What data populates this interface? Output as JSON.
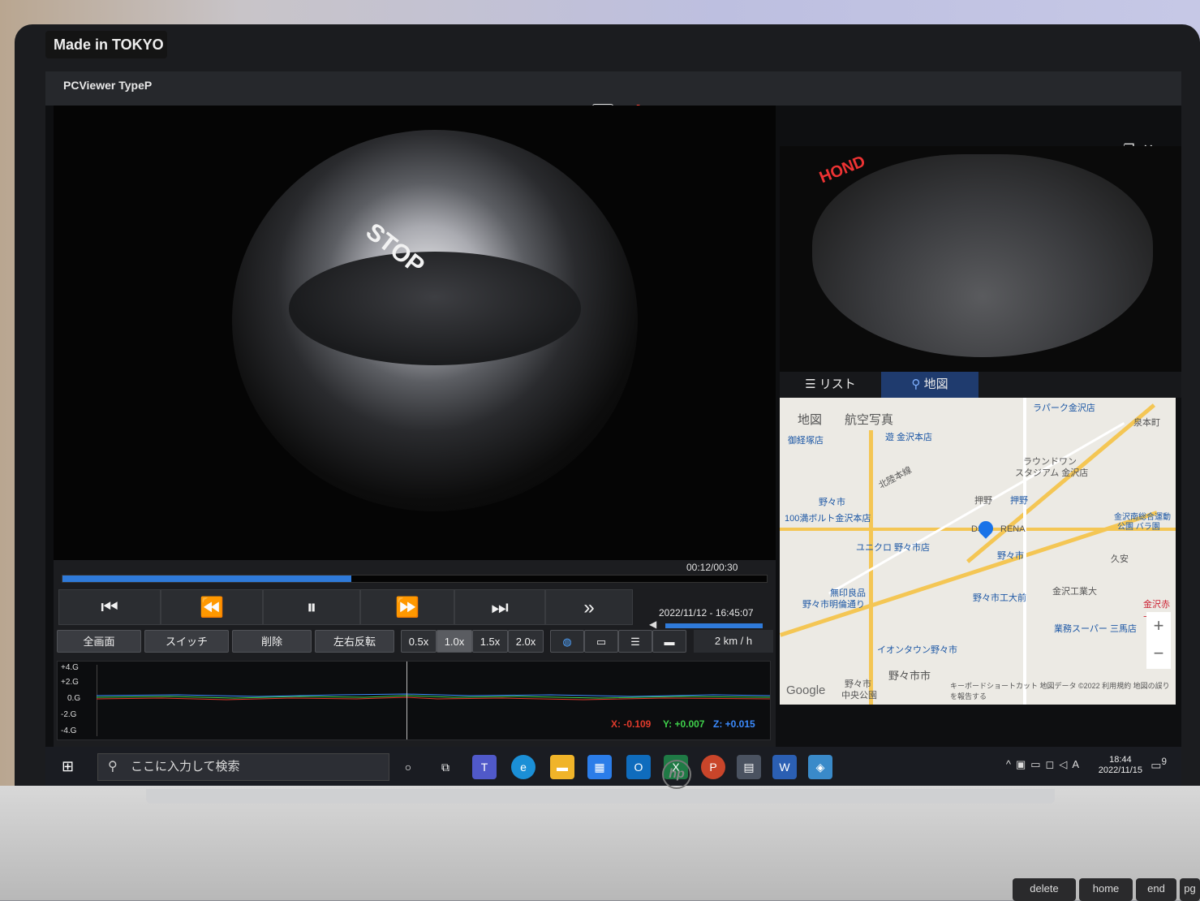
{
  "bezel": {
    "badge": "Made in TOKYO"
  },
  "app": {
    "title": "PCViewer TypeP"
  },
  "toolbar_icons": [
    "folder-icon",
    "sd-card-icon",
    "alert-icon",
    "print-icon",
    "camera-icon"
  ],
  "window_controls": {
    "minimize": "–",
    "restore": "❐",
    "close": "✕"
  },
  "main_video": {
    "sign_text": "STOP"
  },
  "rear_video": {
    "sign_text": "HOND"
  },
  "panel_tabs": [
    {
      "label": "リスト",
      "icon": "list-icon"
    },
    {
      "label": "地図",
      "icon": "map-pin-icon",
      "active": true
    }
  ],
  "map": {
    "mode_tabs": [
      "地図",
      "航空写真"
    ],
    "labels": [
      "ラパーク金沢店",
      "泉本町",
      "御経塚店",
      "遊 金沢本店",
      "北陸本線",
      "ラウンドワン",
      "スタジアム 金沢店",
      "野々市",
      "押野",
      "押野",
      "100満ボルト金沢本店",
      "DSC",
      "RENA",
      "金沢南総合運動",
      "公園 バラ園",
      "ユニクロ 野々市店",
      "野々市",
      "久安",
      "無印良品",
      "野々市明倫通り",
      "野々市工大前",
      "金沢工業大",
      "金沢赤十",
      "業務スーパー 三馬店",
      "イオンタウン野々市",
      "野々市",
      "中央公園",
      "野々市市"
    ],
    "attribution": "キーボードショートカット 地図データ ©2022 利用規約 地図の誤りを報告する",
    "logo": "Google",
    "zoom_in": "+",
    "zoom_out": "−"
  },
  "playback": {
    "time": "00:12/00:30",
    "progress": 0.41,
    "datetime": "2022/11/12 - 16:45:07",
    "volume": 1.0,
    "buttons": [
      "skip-start-icon",
      "rewind-icon",
      "pause-icon",
      "fast-forward-icon",
      "skip-end-icon",
      "double-chevron-icon"
    ]
  },
  "function_buttons": [
    "全画面",
    "スイッチ",
    "削除",
    "左右反転"
  ],
  "speed_buttons": [
    "0.5x",
    "1.0x",
    "1.5x",
    "2.0x"
  ],
  "speed_selected": "1.0x",
  "view_buttons": [
    "globe-icon",
    "single-view-icon",
    "split-view-icon",
    "wide-view-icon"
  ],
  "speedometer": "2 km / h",
  "gsensor": {
    "labels": [
      "+4.G",
      "+2.G",
      "0.G",
      "-2.G",
      "-4.G"
    ],
    "x_label": "X: -0.109",
    "y_label": "Y: +0.007",
    "z_label": "Z: +0.015",
    "colors": {
      "x": "#e23b2c",
      "y": "#3fd14b",
      "z": "#3b8bff"
    }
  },
  "taskbar": {
    "search_placeholder": "ここに入力して検索",
    "apps": [
      "cortana-icon",
      "task-view-icon",
      "teams-icon",
      "edge-icon",
      "file-explorer-icon",
      "store-icon",
      "outlook-icon",
      "excel-icon",
      "powerpoint-icon",
      "calculator-icon",
      "word-icon",
      "pcviewer-icon"
    ],
    "ime": "A",
    "time": "18:44",
    "date": "2022/11/15",
    "notifications": "9"
  },
  "keyboard": {
    "keys": [
      "delete",
      "home",
      "end",
      "pg"
    ]
  }
}
